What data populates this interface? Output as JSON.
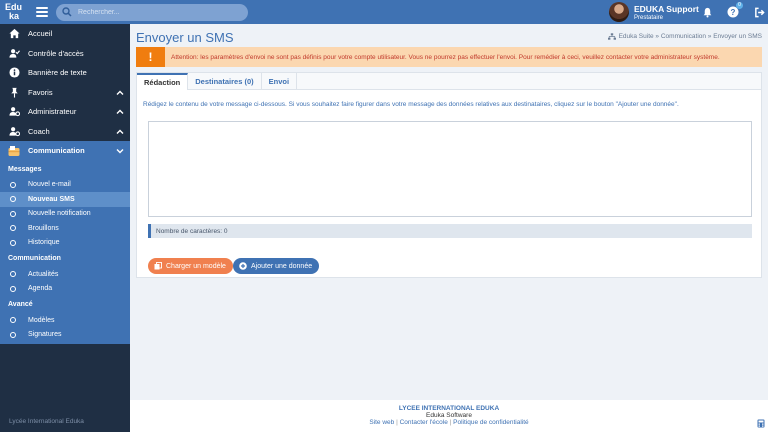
{
  "header": {
    "logo_line1": "Edu",
    "logo_line2": "ka",
    "search_placeholder": "Rechercher...",
    "user_name": "EDUKA Support",
    "user_role": "Prestataire",
    "help_badge": "0"
  },
  "sidebar": {
    "items": [
      {
        "label": "Accueil",
        "icon": "home-icon"
      },
      {
        "label": "Contrôle d'accès",
        "icon": "user-check-icon"
      },
      {
        "label": "Bannière de texte",
        "icon": "info-icon"
      },
      {
        "label": "Favoris",
        "icon": "pin-icon"
      },
      {
        "label": "Administrateur",
        "icon": "user-gear-icon"
      },
      {
        "label": "Coach",
        "icon": "user-gear-icon"
      },
      {
        "label": "Communication",
        "icon": "mailbox-icon"
      }
    ],
    "sections": [
      {
        "title": "Messages",
        "items": [
          "Nouvel e-mail",
          "Nouveau SMS",
          "Nouvelle notification",
          "Brouillons",
          "Historique"
        ]
      },
      {
        "title": "Communication",
        "items": [
          "Actualités",
          "Agenda"
        ]
      },
      {
        "title": "Avancé",
        "items": [
          "Modèles",
          "Signatures"
        ]
      }
    ],
    "footer": "Lycée International Eduka"
  },
  "main": {
    "title": "Envoyer un SMS",
    "breadcrumb": "Eduka Suite » Communication » Envoyer un SMS",
    "alert": "Attention: les paramètres d'envoi ne sont pas définis pour votre compte utilisateur. Vous ne pourrez pas effectuer l'envoi. Pour remédier à ceci, veuillez contacter votre administrateur système.",
    "tabs": [
      "Rédaction",
      "Destinataires (0)",
      "Envoi"
    ],
    "intro": "Rédigez le contenu de votre message ci-dessous. Si vous souhaitez faire figurer dans votre message des données relatives aux destinataires, cliquez sur le bouton \"Ajouter une donnée\".",
    "message_value": "",
    "counter": "Nombre de caractères: 0",
    "btn_model": "Charger un modèle",
    "btn_data": "Ajouter une donnée"
  },
  "footer": {
    "org": "LYCEE INTERNATIONAL EDUKA",
    "software": "Eduka Software",
    "link1": "Site web",
    "link2": "Contacter l'école",
    "link3": "Politique de confidentialité",
    "sep": "|"
  },
  "colors": {
    "primary": "#3f72b3",
    "sidebar": "#1f2f44",
    "alert_bg": "#fbd7b0",
    "alert_icon": "#f07d0f",
    "orange_button": "#f0804f"
  }
}
